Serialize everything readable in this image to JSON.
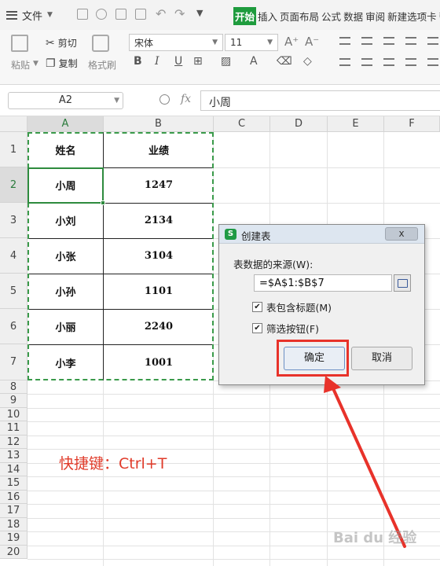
{
  "menu": {
    "file_label": "文件",
    "tabs": [
      "开始",
      "插入",
      "页面布局",
      "公式",
      "数据",
      "审阅",
      "新建选项卡",
      "帮"
    ],
    "active_tab": "开始"
  },
  "ribbon": {
    "paste_label": "粘贴",
    "cut_label": "剪切",
    "copy_label": "复制",
    "format_painter_label": "格式刷",
    "font_name": "宋体",
    "font_size": "11",
    "bold": "B",
    "italic": "I",
    "underline": "U"
  },
  "formula_bar": {
    "name_box": "A2",
    "fx_label": "fx",
    "content": "小周"
  },
  "sheet": {
    "columns": [
      "A",
      "B",
      "C",
      "D",
      "E",
      "F"
    ],
    "rows": [
      "1",
      "2",
      "3",
      "4",
      "5",
      "6",
      "7",
      "8",
      "9",
      "10",
      "11",
      "12",
      "13",
      "14",
      "15",
      "16",
      "17",
      "18",
      "19",
      "20"
    ],
    "table": [
      [
        "姓名",
        "业绩"
      ],
      [
        "小周",
        "1247"
      ],
      [
        "小刘",
        "2134"
      ],
      [
        "小张",
        "3104"
      ],
      [
        "小孙",
        "1101"
      ],
      [
        "小丽",
        "2240"
      ],
      [
        "小李",
        "1001"
      ]
    ],
    "selected_cell": "A2"
  },
  "annotation": {
    "shortcut_text": "快捷键：Ctrl+T",
    "color": "#e03b2a"
  },
  "dialog": {
    "title": "创建表",
    "close_label": "x",
    "source_label": "表数据的来源(W):",
    "source_value": "=$A$1:$B$7",
    "checkbox_header_label": "表包含标题(M)",
    "checkbox_header_checked": true,
    "checkbox_filter_label": "筛选按钮(F)",
    "checkbox_filter_checked": true,
    "ok_label": "确定",
    "cancel_label": "取消"
  },
  "watermark": "Bai du 经验",
  "colors": {
    "accent_green": "#1e9b3d",
    "selection_green": "#2e8b3e",
    "highlight_red": "#e8322a"
  }
}
